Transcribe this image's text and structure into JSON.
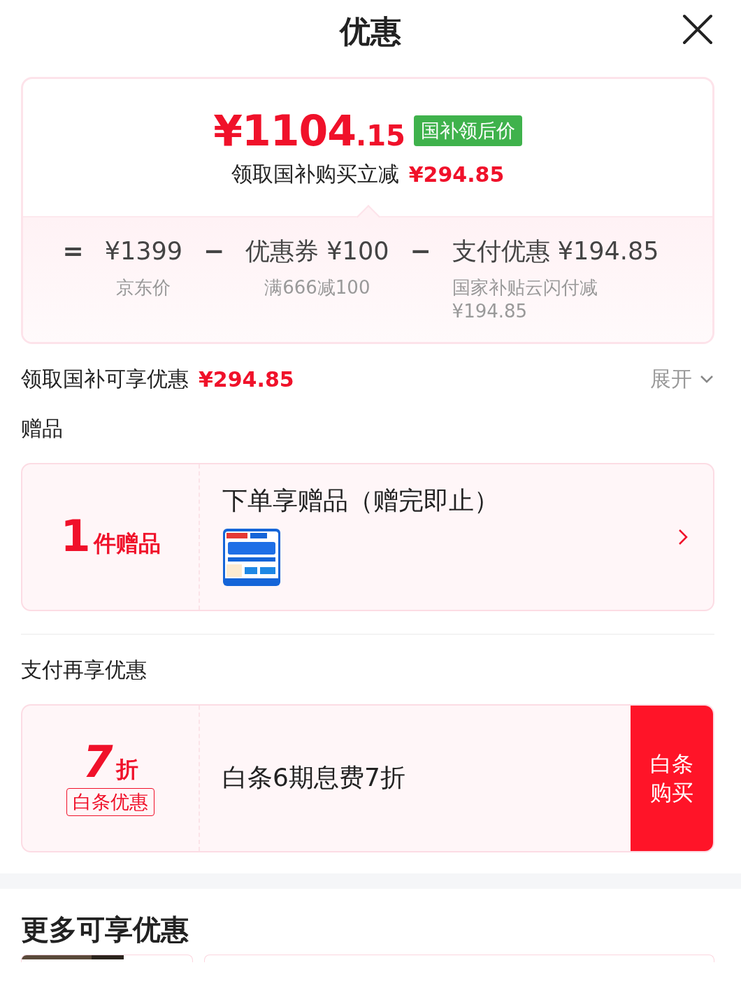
{
  "title": "优惠",
  "price": {
    "main": "¥1104",
    "decimal": ".15",
    "badge": "国补领后价",
    "note": "领取国补购买立减",
    "note_amount": "¥294.85"
  },
  "formula": [
    {
      "op": "=",
      "value": "¥1399",
      "label": "京东价"
    },
    {
      "op": "−",
      "value": "优惠券 ¥100",
      "label": "满666减100"
    },
    {
      "op": "−",
      "value": "支付优惠 ¥194.85",
      "label": "国家补贴云闪付减¥194.85"
    }
  ],
  "subsidy": {
    "label": "领取国补可享优惠",
    "amount": "¥294.85",
    "toggle": "展开",
    "expanded": false
  },
  "gifts": {
    "heading": "赠品",
    "count": "1",
    "unit": "件赠品",
    "title": "下单享赠品（赠完即止）"
  },
  "payment": {
    "heading": "支付再享优惠",
    "discount": "7",
    "unit": "折",
    "tag": "白条优惠",
    "description": "白条6期息费7折",
    "button": "白条购买"
  },
  "more": {
    "heading": "更多可享优惠"
  }
}
